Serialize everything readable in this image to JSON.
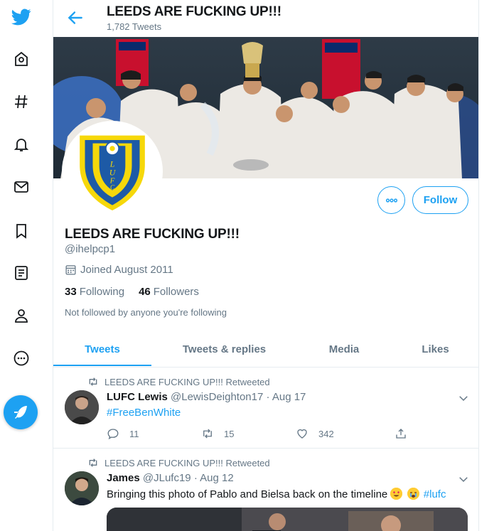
{
  "profile": {
    "header_title": "LEEDS ARE FUCKING UP!!!",
    "tweet_count": "1,782 Tweets",
    "name": "LEEDS ARE FUCKING UP!!!",
    "handle": "@ihelpcp1",
    "joined": "Joined August 2011",
    "following_count": "33",
    "following_label": "Following",
    "followers_count": "46",
    "followers_label": "Followers",
    "not_followed_text": "Not followed by anyone you're following",
    "follow_button": "Follow",
    "crest_text": "LUFC"
  },
  "tabs": [
    {
      "label": "Tweets",
      "active": true
    },
    {
      "label": "Tweets & replies",
      "active": false
    },
    {
      "label": "Media",
      "active": false
    },
    {
      "label": "Likes",
      "active": false
    }
  ],
  "tweets": [
    {
      "retweet_label": "LEEDS ARE FUCKING UP!!! Retweeted",
      "author": "LUFC Lewis",
      "handle": "@LewisDeighton17",
      "separator": "·",
      "date": "Aug 17",
      "text": "#FreeBenWhite",
      "replies": "11",
      "retweets": "15",
      "likes": "342"
    },
    {
      "retweet_label": "LEEDS ARE FUCKING UP!!! Retweeted",
      "author": "James",
      "handle": "@JLufc19",
      "separator": "·",
      "date": "Aug 12",
      "text": "Bringing this photo of Pablo and Bielsa back on the timeline",
      "hashtag": "#lufc"
    }
  ],
  "icons": [
    "twitter-logo-icon",
    "home-icon",
    "explore-hash-icon",
    "notifications-bell-icon",
    "messages-envelope-icon",
    "bookmarks-icon",
    "lists-icon",
    "profile-person-icon",
    "more-circle-icon",
    "compose-feather-icon"
  ],
  "colors": {
    "accent": "#1da1f2",
    "secondary_text": "#657786",
    "border": "#e6ecf0",
    "crest_blue": "#1d5aa6",
    "crest_yellow": "#f6d80a"
  }
}
